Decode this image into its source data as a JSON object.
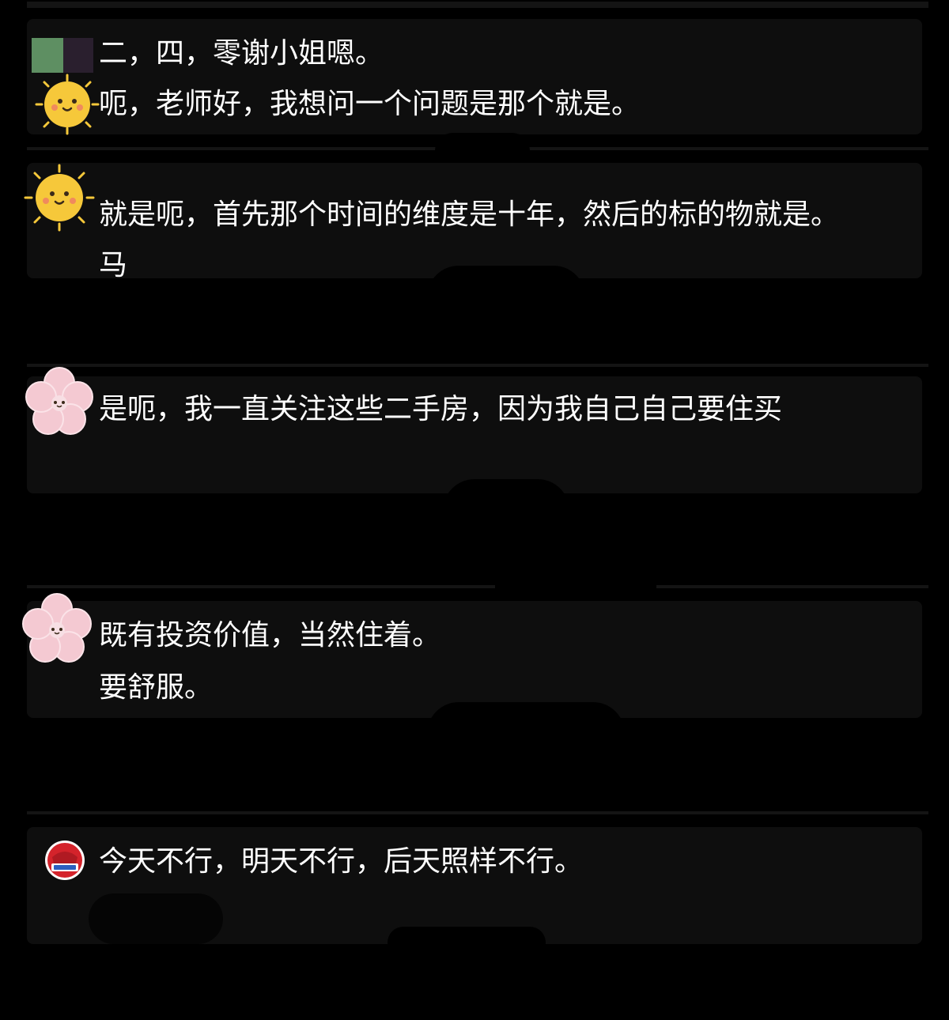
{
  "messages": [
    {
      "avatar": "green-square-avatar",
      "lines": [
        "二，四，零谢小姐嗯。"
      ]
    },
    {
      "avatar": "sun-avatar",
      "lines": [
        "呃，老师好，我想问一个问题是那个就是。"
      ]
    },
    {
      "avatar": "sun-avatar",
      "lines": [
        "就是呃，首先那个时间的维度是十年，然后的标的物就是。",
        "马"
      ]
    },
    {
      "avatar": "cherry-blossom-avatar",
      "lines": [
        "是呃，我一直关注这些二手房，因为我自己自己要住买"
      ]
    },
    {
      "avatar": "cherry-blossom-avatar",
      "lines": [
        "既有投资价值，当然住着。",
        "要舒服。"
      ]
    },
    {
      "avatar": "red-badge-avatar",
      "lines": [
        "今天不行，明天不行，后天照样不行。"
      ]
    }
  ],
  "colors": {
    "background": "#000000",
    "card": "#0e0e0e",
    "text": "#ffffff",
    "sun": "#f6c83a",
    "blossom": "#f4c9d2",
    "badge": "#d4232b"
  }
}
